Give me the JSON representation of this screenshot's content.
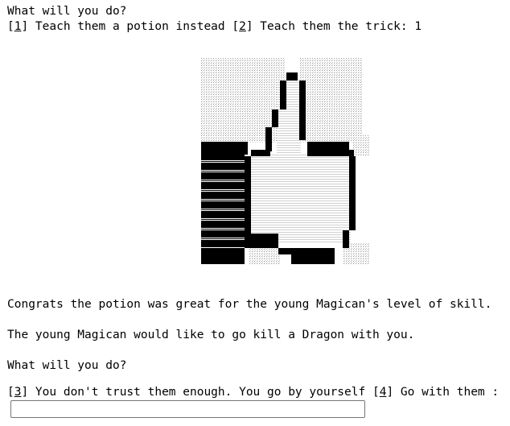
{
  "prompt_top": {
    "question": "What will you do?",
    "option_1_key": "1",
    "option_1_text": " Teach them a potion instead ",
    "option_2_key": "2",
    "option_2_text": " Teach them the trick: 1"
  },
  "art": {
    "icon": "thumbs-up-icon",
    "ink_color": "#000000",
    "stipple_color": "#bdbdbd"
  },
  "story": {
    "congrats": "Congrats the potion was great for the young Magican's level of skill.",
    "dragon": "The young Magican would like to go kill a Dragon with you.",
    "question": "What will you do?",
    "option_3_key": "3",
    "option_3_text": " You don't trust them enough. You go by yourself ",
    "option_4_key": "4",
    "option_4_text": " Go with them :"
  },
  "input": {
    "value": "",
    "placeholder": ""
  }
}
